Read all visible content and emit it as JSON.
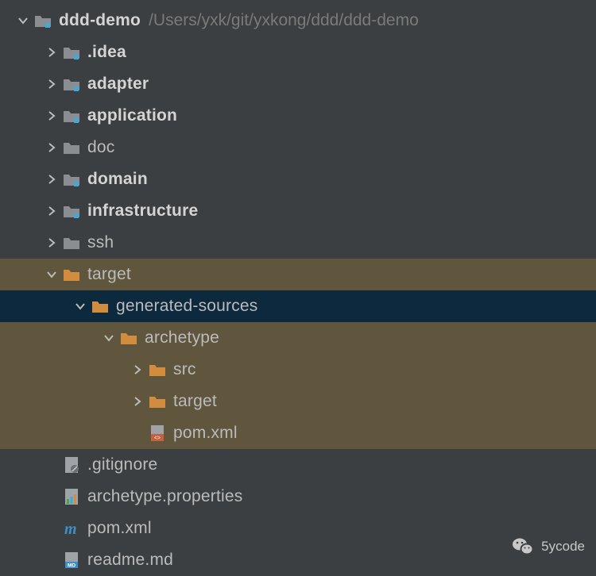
{
  "project": {
    "name": "ddd-demo",
    "path": "/Users/yxk/git/yxkong/ddd/ddd-demo"
  },
  "tree": [
    {
      "id": "idea",
      "label": ".idea",
      "depth": 1,
      "arrow": "right",
      "icon": "module-folder",
      "bold": true,
      "hl": false,
      "sel": false
    },
    {
      "id": "adapter",
      "label": "adapter",
      "depth": 1,
      "arrow": "right",
      "icon": "module-folder",
      "bold": true,
      "hl": false,
      "sel": false
    },
    {
      "id": "application",
      "label": "application",
      "depth": 1,
      "arrow": "right",
      "icon": "module-folder",
      "bold": true,
      "hl": false,
      "sel": false
    },
    {
      "id": "doc",
      "label": "doc",
      "depth": 1,
      "arrow": "right",
      "icon": "folder-grey",
      "bold": false,
      "hl": false,
      "sel": false
    },
    {
      "id": "domain",
      "label": "domain",
      "depth": 1,
      "arrow": "right",
      "icon": "module-folder",
      "bold": true,
      "hl": false,
      "sel": false
    },
    {
      "id": "infrastructure",
      "label": "infrastructure",
      "depth": 1,
      "arrow": "right",
      "icon": "module-folder",
      "bold": true,
      "hl": false,
      "sel": false
    },
    {
      "id": "ssh",
      "label": "ssh",
      "depth": 1,
      "arrow": "right",
      "icon": "folder-grey",
      "bold": false,
      "hl": false,
      "sel": false
    },
    {
      "id": "target",
      "label": "target",
      "depth": 1,
      "arrow": "down",
      "icon": "folder-orange",
      "bold": false,
      "hl": true,
      "sel": false
    },
    {
      "id": "gensrc",
      "label": "generated-sources",
      "depth": 2,
      "arrow": "down",
      "icon": "folder-orange",
      "bold": false,
      "hl": false,
      "sel": true
    },
    {
      "id": "archetype",
      "label": "archetype",
      "depth": 3,
      "arrow": "down",
      "icon": "folder-orange",
      "bold": false,
      "hl": true,
      "sel": false
    },
    {
      "id": "src",
      "label": "src",
      "depth": 4,
      "arrow": "right",
      "icon": "folder-orange",
      "bold": false,
      "hl": true,
      "sel": false
    },
    {
      "id": "target2",
      "label": "target",
      "depth": 4,
      "arrow": "right",
      "icon": "folder-orange",
      "bold": false,
      "hl": true,
      "sel": false
    },
    {
      "id": "pomxml2",
      "label": "pom.xml",
      "depth": 4,
      "arrow": "none",
      "icon": "xml-file",
      "bold": false,
      "hl": true,
      "sel": false
    },
    {
      "id": "gitignore",
      "label": ".gitignore",
      "depth": 1,
      "arrow": "none",
      "icon": "gitignore-file",
      "bold": false,
      "hl": false,
      "sel": false
    },
    {
      "id": "archprops",
      "label": "archetype.properties",
      "depth": 1,
      "arrow": "none",
      "icon": "props-file",
      "bold": false,
      "hl": false,
      "sel": false
    },
    {
      "id": "pomxml",
      "label": "pom.xml",
      "depth": 1,
      "arrow": "none",
      "icon": "maven-file",
      "bold": false,
      "hl": false,
      "sel": false
    },
    {
      "id": "readme",
      "label": "readme.md",
      "depth": 1,
      "arrow": "none",
      "icon": "md-file",
      "bold": false,
      "hl": false,
      "sel": false
    }
  ],
  "watermark": {
    "label": "5ycode"
  },
  "root": {
    "depth": 0,
    "arrow": "down",
    "icon": "module-folder",
    "bold": true
  }
}
